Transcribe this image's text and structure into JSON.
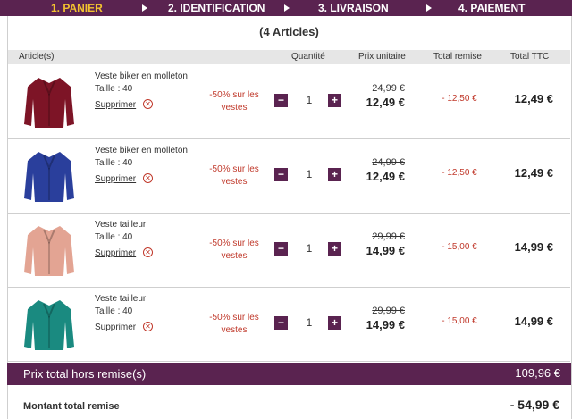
{
  "steps": [
    {
      "label": "1. PANIER"
    },
    {
      "label": "2. IDENTIFICATION"
    },
    {
      "label": "3. LIVRAISON"
    },
    {
      "label": "4. PAIEMENT"
    }
  ],
  "colors": {
    "brand": "#5a2350",
    "active_step": "#f2c230",
    "discount": "#c0392b"
  },
  "cart": {
    "count_label": "(4 Articles)",
    "headers": {
      "article": "Article(s)",
      "quantity": "Quantité",
      "unit_price": "Prix unitaire",
      "discount_total": "Total remise",
      "total_ttc": "Total TTC"
    },
    "items": [
      {
        "name": "Veste biker en molleton",
        "size": "Taille : 40",
        "remove": "Supprimer",
        "promo": "-50% sur les vestes",
        "qty": "1",
        "old_price": "24,99 €",
        "price": "12,49 €",
        "discount": "- 12,50 €",
        "total": "12,49 €",
        "color": "#7d1426"
      },
      {
        "name": "Veste biker en molleton",
        "size": "Taille : 40",
        "remove": "Supprimer",
        "promo": "-50% sur les vestes",
        "qty": "1",
        "old_price": "24,99 €",
        "price": "12,49 €",
        "discount": "- 12,50 €",
        "total": "12,49 €",
        "color": "#2a3f9c"
      },
      {
        "name": "Veste tailleur",
        "size": "Taille : 40",
        "remove": "Supprimer",
        "promo": "-50% sur les vestes",
        "qty": "1",
        "old_price": "29,99 €",
        "price": "14,99 €",
        "discount": "- 15,00 €",
        "total": "14,99 €",
        "color": "#e3a493"
      },
      {
        "name": "Veste tailleur",
        "size": "Taille : 40",
        "remove": "Supprimer",
        "promo": "-50% sur les vestes",
        "qty": "1",
        "old_price": "29,99 €",
        "price": "14,99 €",
        "discount": "- 15,00 €",
        "total": "14,99 €",
        "color": "#1a8a80"
      }
    ],
    "total_label": "Prix total hors remise(s)",
    "total_value": "109,96 €",
    "discount_label": "Montant total remise",
    "discount_value": "- 54,99 €"
  }
}
